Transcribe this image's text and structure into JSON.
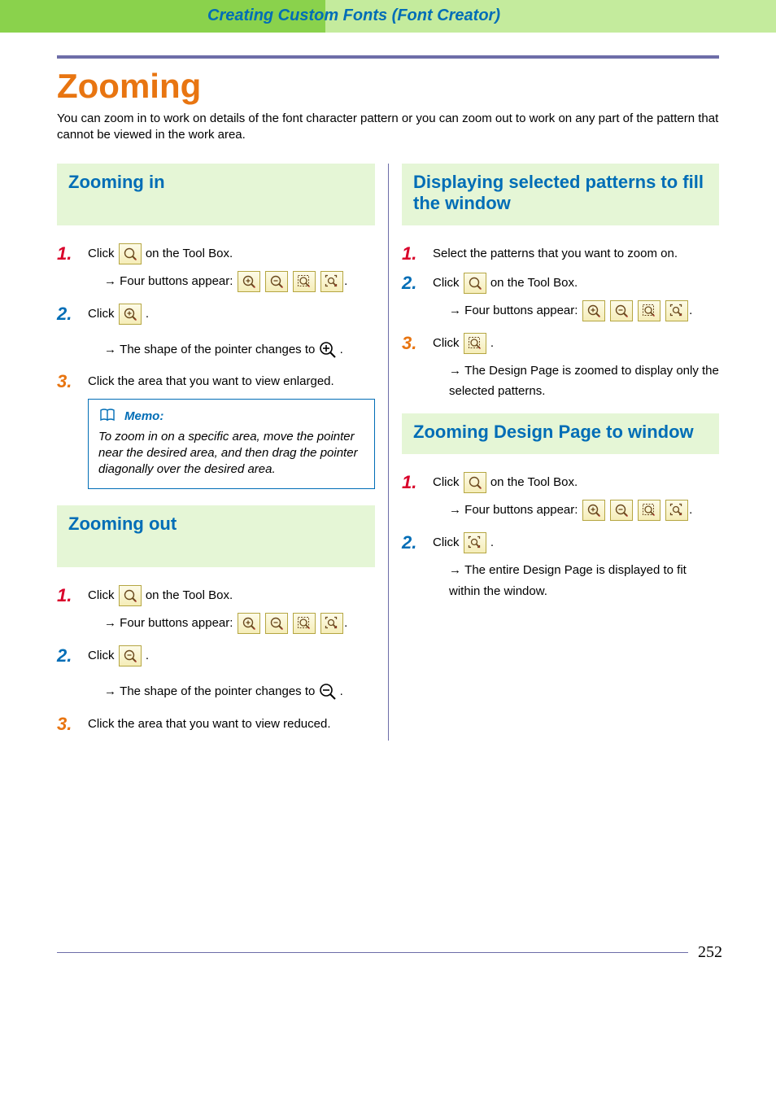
{
  "header": {
    "breadcrumb": "Creating Custom Fonts (Font Creator)"
  },
  "title": "Zooming",
  "intro": "You can zoom in to work on details of the font character pattern or you can zoom out to work on any part of the pattern that cannot be viewed in the work area.",
  "zoom_in": {
    "heading": "Zooming in",
    "s1a": "Click ",
    "s1b": " on the Tool Box.",
    "four": "Four buttons appear: ",
    "s2a": "Click ",
    "s2b": ".",
    "shape": "The shape of the pointer changes to ",
    "s3": "Click the area that you want to view enlarged."
  },
  "memo": {
    "label": "Memo:",
    "text": "To zoom in on a specific area, move the pointer near the desired area, and then drag the pointer diagonally over the desired area."
  },
  "zoom_out": {
    "heading": "Zooming out",
    "s1a": "Click ",
    "s1b": " on the Tool Box.",
    "four": "Four buttons appear: ",
    "s2a": "Click ",
    "s2b": ".",
    "shape": "The shape of the pointer changes to ",
    "s3": "Click the area that you want to view reduced."
  },
  "disp_sel": {
    "heading": "Displaying selected patterns to fill the window",
    "s1": "Select the patterns that you want to zoom on.",
    "s2a": "Click ",
    "s2b": " on the Tool Box.",
    "four": "Four buttons appear: ",
    "s3a": "Click ",
    "s3b": ".",
    "result": "The Design Page is zoomed to display only the selected patterns."
  },
  "zoom_page": {
    "heading": "Zooming Design Page to window",
    "s1a": "Click ",
    "s1b": " on the Tool Box.",
    "four": "Four buttons appear: ",
    "s2a": "Click ",
    "s2b": ".",
    "result": "The entire Design Page is displayed to fit within the window."
  },
  "page_number": "252"
}
